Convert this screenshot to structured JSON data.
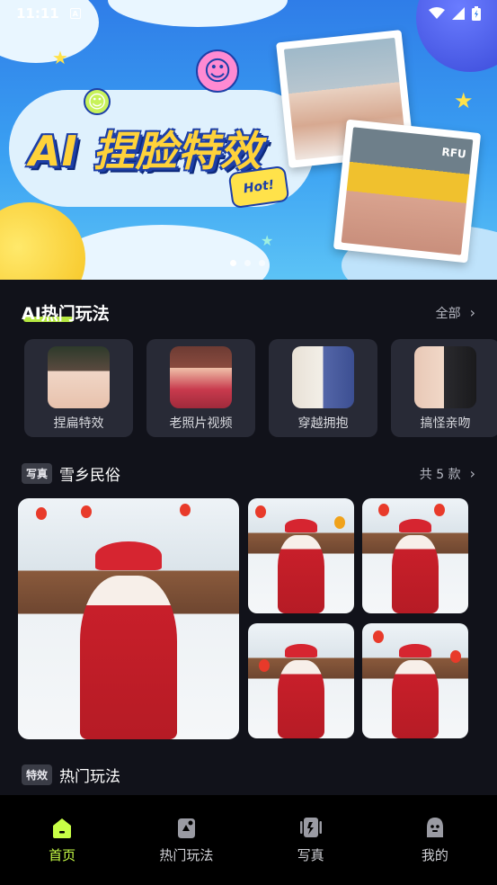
{
  "status_bar": {
    "time": "11:11",
    "notif_letter": "A"
  },
  "banner": {
    "title": "AI 捏脸特效",
    "badge": "Hot!",
    "photo_sign": "RFU",
    "page_count": 3,
    "active_page": 0
  },
  "hot_section": {
    "title": "AI热门玩法",
    "more_label": "全部",
    "items": [
      {
        "label": "捏扁特效"
      },
      {
        "label": "老照片视频"
      },
      {
        "label": "穿越拥抱"
      },
      {
        "label": "搞怪亲吻"
      }
    ]
  },
  "photo_section": {
    "tag": "写真",
    "name": "雪乡民俗",
    "count_label": "共 5 款"
  },
  "effects_section": {
    "tag": "特效",
    "name": "热门玩法"
  },
  "nav": {
    "items": [
      {
        "label": "首页",
        "icon": "home-icon",
        "active": true
      },
      {
        "label": "热门玩法",
        "icon": "fire-icon",
        "active": false
      },
      {
        "label": "写真",
        "icon": "portrait-icon",
        "active": false
      },
      {
        "label": "我的",
        "icon": "profile-icon",
        "active": false
      }
    ]
  },
  "colors": {
    "accent": "#c8ff46",
    "background": "#11121a",
    "card": "#282a36"
  }
}
